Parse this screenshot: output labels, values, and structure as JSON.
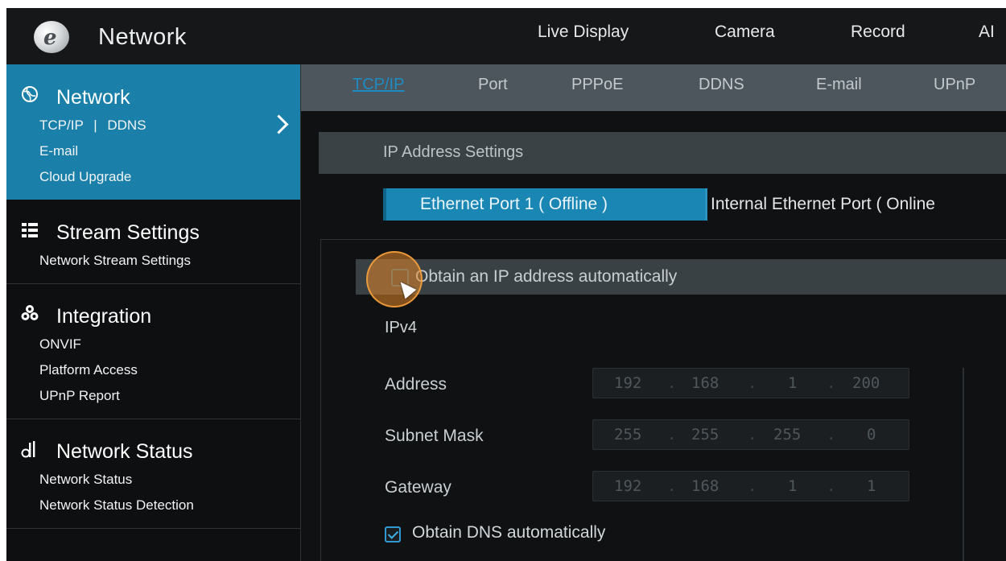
{
  "header": {
    "title": "Network",
    "nav": [
      "Live Display",
      "Camera",
      "Record",
      "AI"
    ]
  },
  "sidebar": {
    "sections": [
      {
        "title": "Network",
        "icon": "network-globe-icon",
        "items": [
          "TCP/IP",
          "DDNS",
          "E-mail",
          "Cloud Upgrade"
        ],
        "separator": "|"
      },
      {
        "title": "Stream Settings",
        "icon": "list-icon",
        "items": [
          "Network Stream Settings"
        ]
      },
      {
        "title": "Integration",
        "icon": "integration-icon",
        "items": [
          "ONVIF",
          "Platform Access",
          "UPnP Report"
        ]
      },
      {
        "title": "Network Status",
        "icon": "signal-icon",
        "items": [
          "Network Status",
          "Network Status Detection"
        ]
      }
    ]
  },
  "tabs": [
    "TCP/IP",
    "Port",
    "PPPoE",
    "DDNS",
    "E-mail",
    "UPnP"
  ],
  "ip_settings": {
    "title": "IP Address Settings",
    "port_tabs": [
      "Ethernet Port 1 ( Offline )",
      "Internal Ethernet Port ( Online"
    ],
    "obtain_ip_label": "Obtain an IP address automatically",
    "ipv4_label": "IPv4",
    "fields": [
      {
        "label": "Address",
        "octets": [
          "192",
          "168",
          "1",
          "200"
        ]
      },
      {
        "label": "Subnet Mask",
        "octets": [
          "255",
          "255",
          "255",
          "0"
        ]
      },
      {
        "label": "Gateway",
        "octets": [
          "192",
          "168",
          "1",
          "1"
        ]
      }
    ],
    "dns_label": "Obtain DNS automatically"
  },
  "colors": {
    "accent": "#1a80aa",
    "active_tab_text": "#1f8bc4",
    "click_highlight": "#e28628"
  }
}
